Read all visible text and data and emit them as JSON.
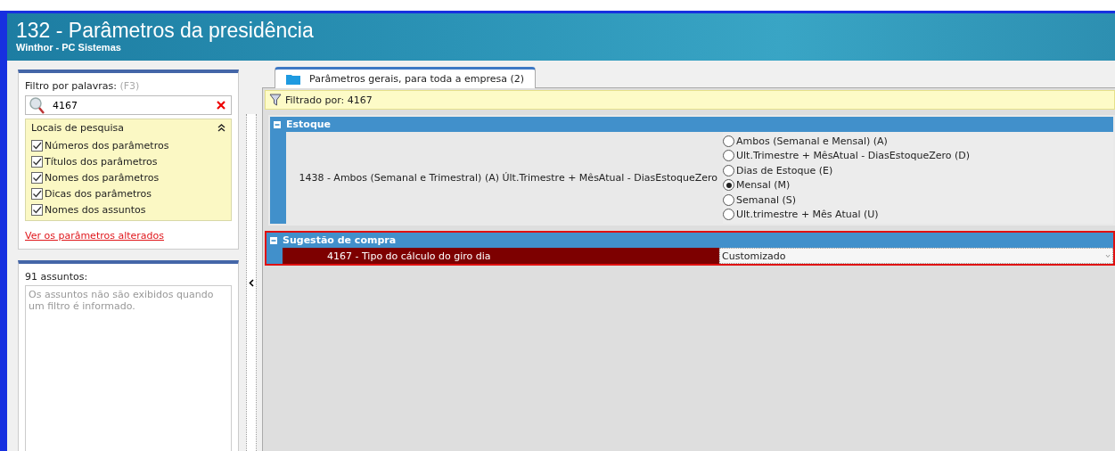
{
  "window": {
    "title": "132 - Parâmetros da presidência",
    "subtitle": "Winthor - PC Sistemas"
  },
  "filter": {
    "label": "Filtro por palavras:",
    "shortcut": "(F3)",
    "value": "4167"
  },
  "search_locations": {
    "title": "Locais de pesquisa",
    "expanded": true,
    "options": [
      {
        "label": "Números dos parâmetros",
        "checked": true
      },
      {
        "label": "Títulos dos parâmetros",
        "checked": true
      },
      {
        "label": "Nomes dos parâmetros",
        "checked": true
      },
      {
        "label": "Dicas dos parâmetros",
        "checked": true
      },
      {
        "label": "Nomes dos assuntos",
        "checked": true
      }
    ]
  },
  "changed_link": "Ver os parâmetros alterados",
  "subjects": {
    "count_label": "91 assuntos:",
    "message": "Os assuntos não são exibidos quando um filtro é informado."
  },
  "tabs": [
    {
      "label": "Parâmetros gerais, para toda a empresa  (2)",
      "selected": true
    }
  ],
  "filter_bar": "Filtrado por: 4167",
  "groups": [
    {
      "title": "Estoque",
      "highlighted": false,
      "parameters": [
        {
          "kind": "radio",
          "label": "1438 - Ambos (Semanal e Trimestral) (A) Últ.Trimestre + MêsAtual - DiasEstoqueZero",
          "selected": false,
          "options": [
            {
              "label": "Ambos (Semanal e Mensal) (A)",
              "selected": false
            },
            {
              "label": "Ult.Trimestre + MêsAtual - DiasEstoqueZero (D)",
              "selected": false
            },
            {
              "label": "Dias de Estoque (E)",
              "selected": false
            },
            {
              "label": "Mensal (M)",
              "selected": true
            },
            {
              "label": "Semanal (S)",
              "selected": false
            },
            {
              "label": "Ult.trimestre + Mês Atual (U)",
              "selected": false
            }
          ]
        }
      ]
    },
    {
      "title": "Sugestão de compra",
      "highlighted": true,
      "parameters": [
        {
          "kind": "dropdown",
          "label": "4167 - Tipo do cálculo do giro dia",
          "selected": true,
          "value": "Customizado"
        }
      ]
    }
  ]
}
